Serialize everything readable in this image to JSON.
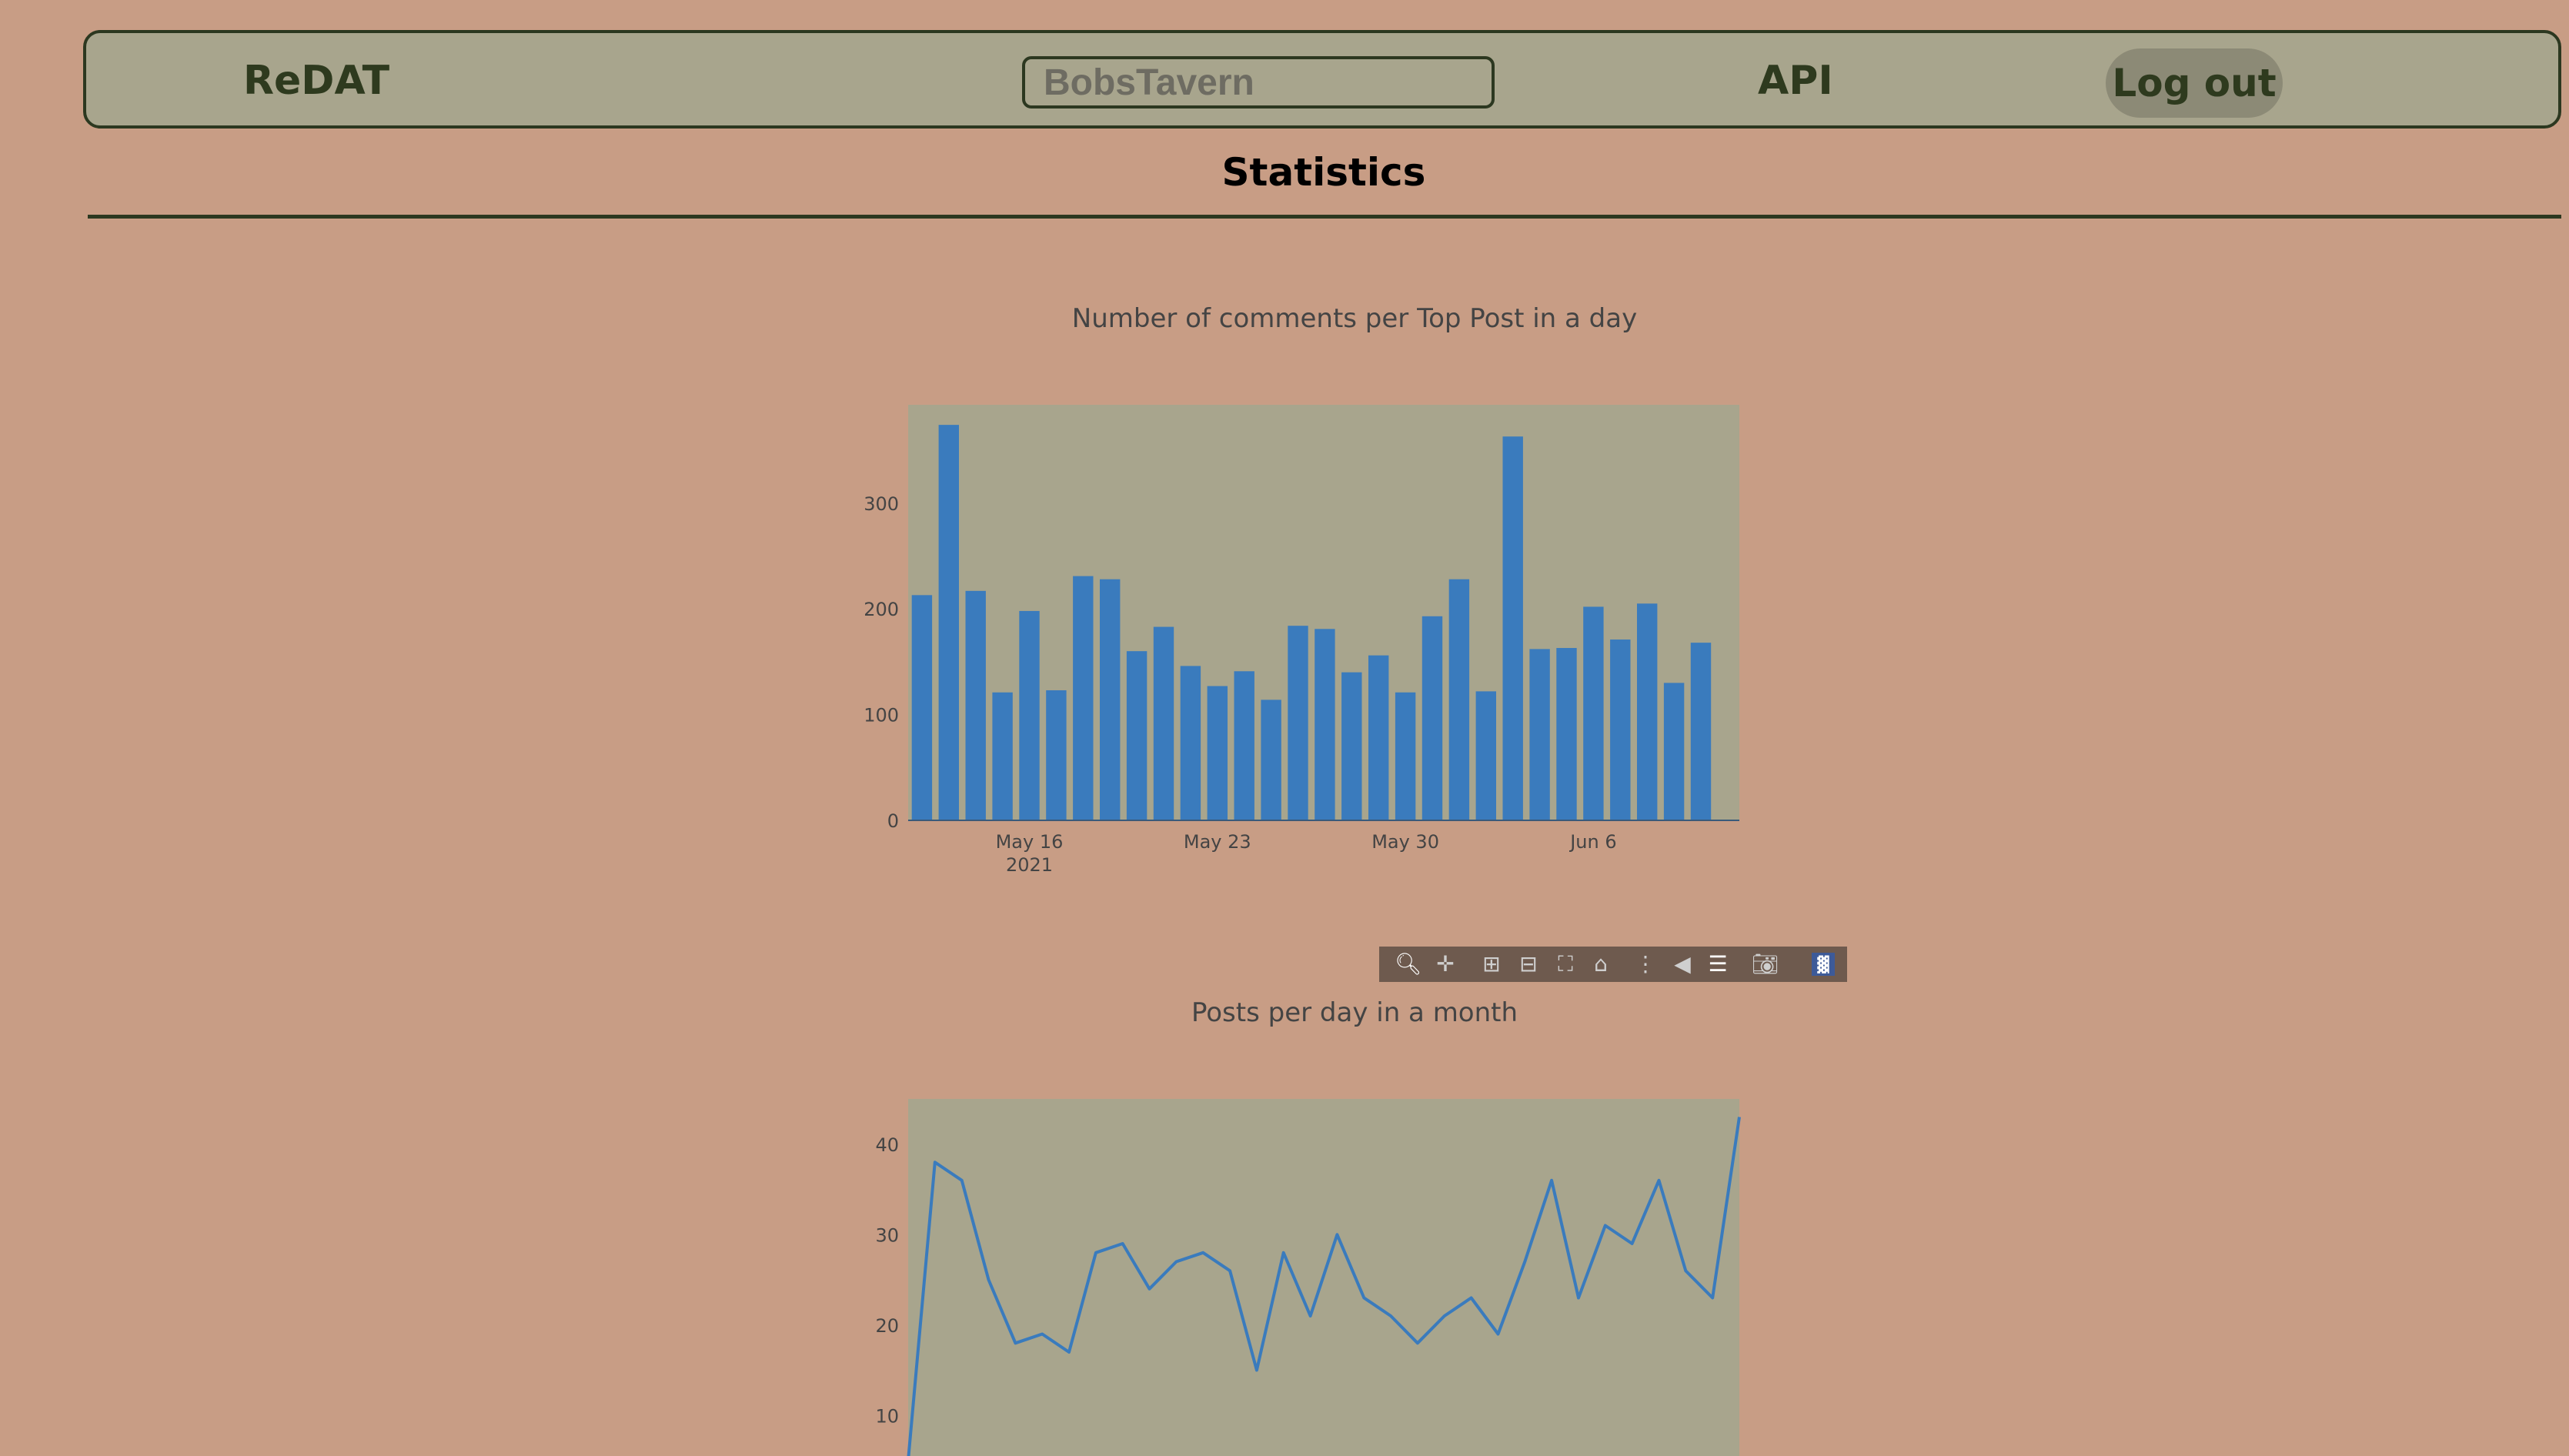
{
  "navbar": {
    "brand": "ReDAT",
    "search_placeholder": "BobsTavern",
    "api_label": "API",
    "logout_label": "Log out"
  },
  "page": {
    "title": "Statistics"
  },
  "colors": {
    "background": "#c89d85",
    "panel": "#a8a58d",
    "accent": "#2e3a1e",
    "series": "#3a7bbd"
  },
  "modebar": {
    "icons": [
      "zoom-icon",
      "pan-icon",
      "zoom-in-icon",
      "zoom-out-icon",
      "autoscale-icon",
      "reset-axes-icon",
      "spike-lines-icon",
      "hover-closest-icon",
      "hover-compare-icon",
      "camera-icon",
      "plotly-logo-icon"
    ]
  },
  "chart_data": [
    {
      "type": "bar",
      "title": "Number of comments per Top Post in a day",
      "xlabel": "",
      "ylabel": "",
      "x_start": "2021-05-12",
      "x_ticks": [
        "May 16",
        "May 23",
        "May 30",
        "Jun 6"
      ],
      "x_tick_dates": [
        "2021-05-16",
        "2021-05-23",
        "2021-05-30",
        "2021-06-06"
      ],
      "x_tick_sublabel": "2021",
      "y_ticks": [
        0,
        100,
        200,
        300
      ],
      "ylim": [
        0,
        393
      ],
      "values": [
        213,
        374,
        217,
        121,
        198,
        123,
        231,
        228,
        160,
        183,
        146,
        127,
        141,
        114,
        184,
        181,
        140,
        156,
        121,
        193,
        228,
        122,
        363,
        162,
        163,
        202,
        171,
        205,
        130,
        168
      ]
    },
    {
      "type": "line",
      "title": "Posts per day in a month",
      "xlabel": "",
      "ylabel": "",
      "y_ticks": [
        10,
        20,
        30,
        40
      ],
      "ylim": [
        5,
        45
      ],
      "values": [
        5,
        38,
        36,
        25,
        18,
        19,
        17,
        28,
        29,
        24,
        27,
        28,
        26,
        15,
        28,
        21,
        30,
        23,
        21,
        18,
        21,
        23,
        19,
        27,
        36,
        23,
        31,
        29,
        36,
        26,
        23,
        43
      ]
    }
  ]
}
